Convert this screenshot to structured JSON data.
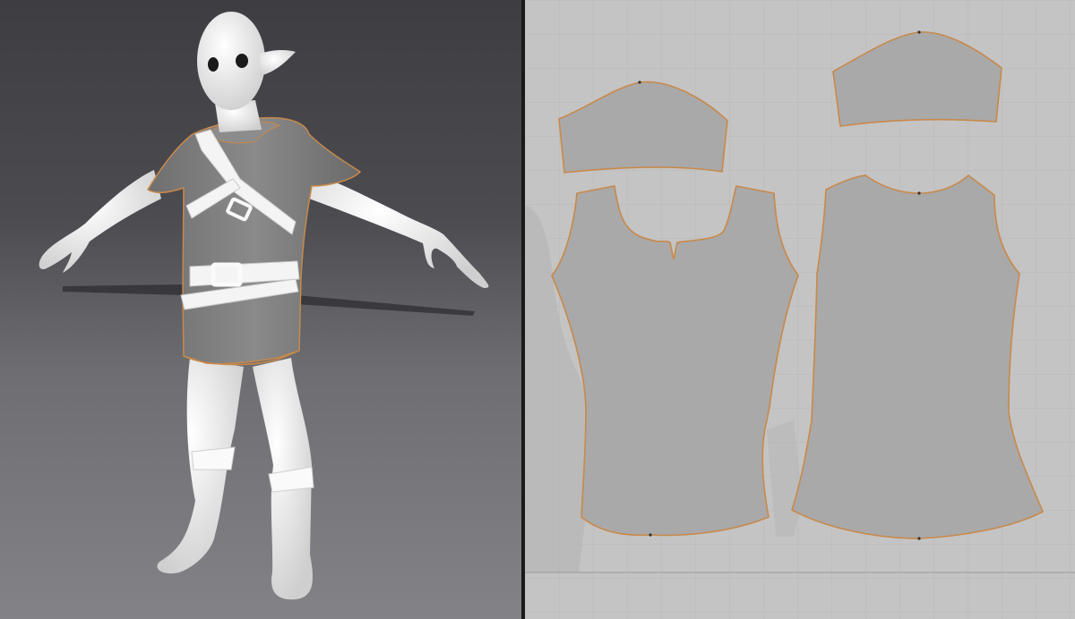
{
  "colors": {
    "viewport_3d_top": "#3e3e42",
    "viewport_3d_bottom": "#838387",
    "viewport_2d_bg": "#c4c4c4",
    "grid_line": "#b8b8b8",
    "pattern_fill": "#a9a9a9",
    "seam_outline": "#c8894a",
    "avatar_skin": "#f2f2f2",
    "tunic_fill": "#7a7a7a",
    "belt_fill": "#f4f4f4"
  },
  "panels": {
    "left": "3d-view",
    "right": "2d-pattern-view"
  },
  "pattern_pieces": [
    "sleeve-left",
    "sleeve-right",
    "front-body",
    "back-body"
  ]
}
